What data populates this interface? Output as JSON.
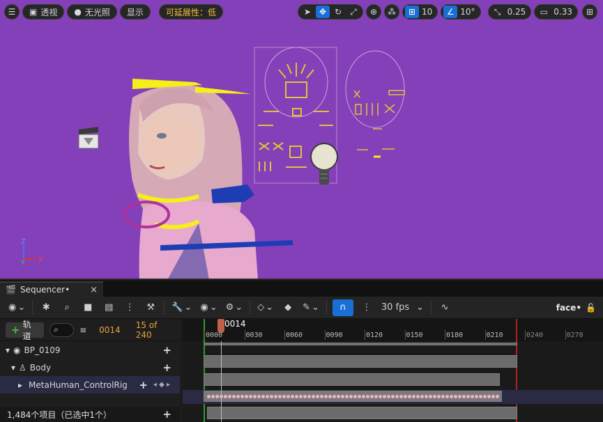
{
  "viewport_toolbar": {
    "menu_icon": "hamburger-icon",
    "perspective_label": "透视",
    "lighting_label": "无光照",
    "show_label": "显示",
    "scalability_label": "可延展性：低",
    "grid_snap_value": "10",
    "rotation_snap_value": "10°",
    "scale_snap_value": "0.25",
    "camera_speed_value": "0.33"
  },
  "sequencer": {
    "tab_title": "Sequencer•",
    "close_label": "×",
    "fps_label": "30 fps",
    "sequence_name": "face•",
    "add_track_label": "轨道",
    "current_frame": "0014",
    "frame_range": "15 of 240",
    "playhead_label": "0014",
    "tree": [
      {
        "label": "BP_0109",
        "icon": "actor-icon"
      },
      {
        "label": "Body",
        "icon": "skeletal-mesh-icon"
      },
      {
        "label": "MetaHuman_ControlRig",
        "icon": "control-rig-icon",
        "selected": true
      }
    ],
    "status_text": "1,484个项目（已选中1个）",
    "ruler_ticks": [
      "0000",
      "0030",
      "0060",
      "0090",
      "0120",
      "0150",
      "0180",
      "0210",
      "0240",
      "0270"
    ]
  },
  "colors": {
    "viewport_bg": "#8340b8",
    "accent_blue": "#1a6fd6",
    "warning_yellow": "#f2c23b",
    "frame_orange": "#e8a53a"
  }
}
